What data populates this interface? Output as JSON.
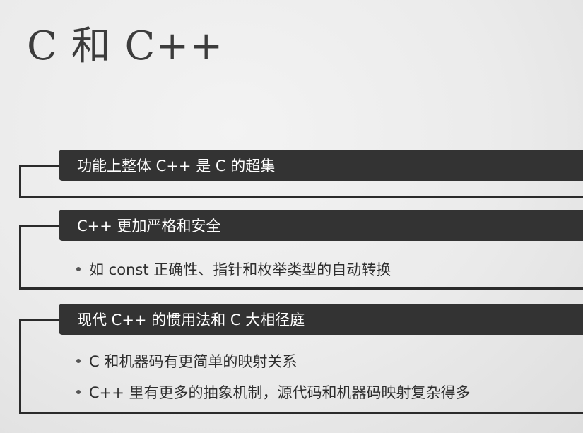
{
  "slide": {
    "title": "C 和 C++",
    "sections": [
      {
        "heading": "功能上整体 C++ 是 C 的超集",
        "bullets": []
      },
      {
        "heading": "C++ 更加严格和安全",
        "bullets": [
          "如 const 正确性、指针和枚举类型的自动转换"
        ]
      },
      {
        "heading": "现代 C++ 的惯用法和 C 大相径庭",
        "bullets": [
          "C 和机器码有更简单的映射关系",
          "C++ 里有更多的抽象机制，源代码和机器码映射复杂得多"
        ]
      }
    ]
  }
}
